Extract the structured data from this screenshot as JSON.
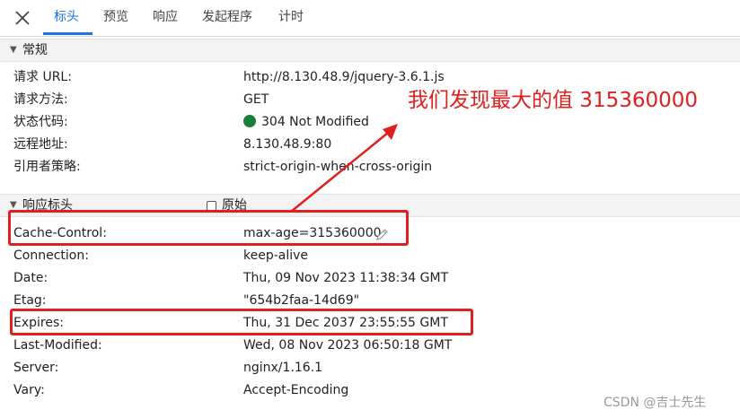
{
  "tabs": [
    {
      "label": "标头",
      "active": true
    },
    {
      "label": "预览",
      "active": false
    },
    {
      "label": "响应",
      "active": false
    },
    {
      "label": "发起程序",
      "active": false
    },
    {
      "label": "计时",
      "active": false
    }
  ],
  "general": {
    "title": "常规",
    "rows": [
      {
        "key": "请求 URL:",
        "value": "http://8.130.48.9/jquery-3.6.1.js"
      },
      {
        "key": "请求方法:",
        "value": "GET"
      },
      {
        "key": "状态代码:",
        "value": "304 Not Modified"
      },
      {
        "key": "远程地址:",
        "value": "8.130.48.9:80"
      },
      {
        "key": "引用者策略:",
        "value": "strict-origin-when-cross-origin"
      }
    ]
  },
  "response_headers": {
    "title": "响应标头",
    "raw_label": "原始",
    "rows": [
      {
        "key": "Cache-Control:",
        "value": "max-age=315360000"
      },
      {
        "key": "Connection:",
        "value": "keep-alive"
      },
      {
        "key": "Date:",
        "value": "Thu, 09 Nov 2023 11:38:34 GMT"
      },
      {
        "key": "Etag:",
        "value": "\"654b2faa-14d69\""
      },
      {
        "key": "Expires:",
        "value": "Thu, 31 Dec 2037 23:55:55 GMT"
      },
      {
        "key": "Last-Modified:",
        "value": "Wed, 08 Nov 2023 06:50:18 GMT"
      },
      {
        "key": "Server:",
        "value": "nginx/1.16.1"
      },
      {
        "key": "Vary:",
        "value": "Accept-Encoding"
      }
    ]
  },
  "annotation": {
    "text": "我们发现最大的值 315360000"
  },
  "watermark": "CSDN @吉士先生",
  "colors": {
    "accent": "#1a73e8",
    "status_ok": "#188038",
    "annotation": "#e0201f"
  }
}
